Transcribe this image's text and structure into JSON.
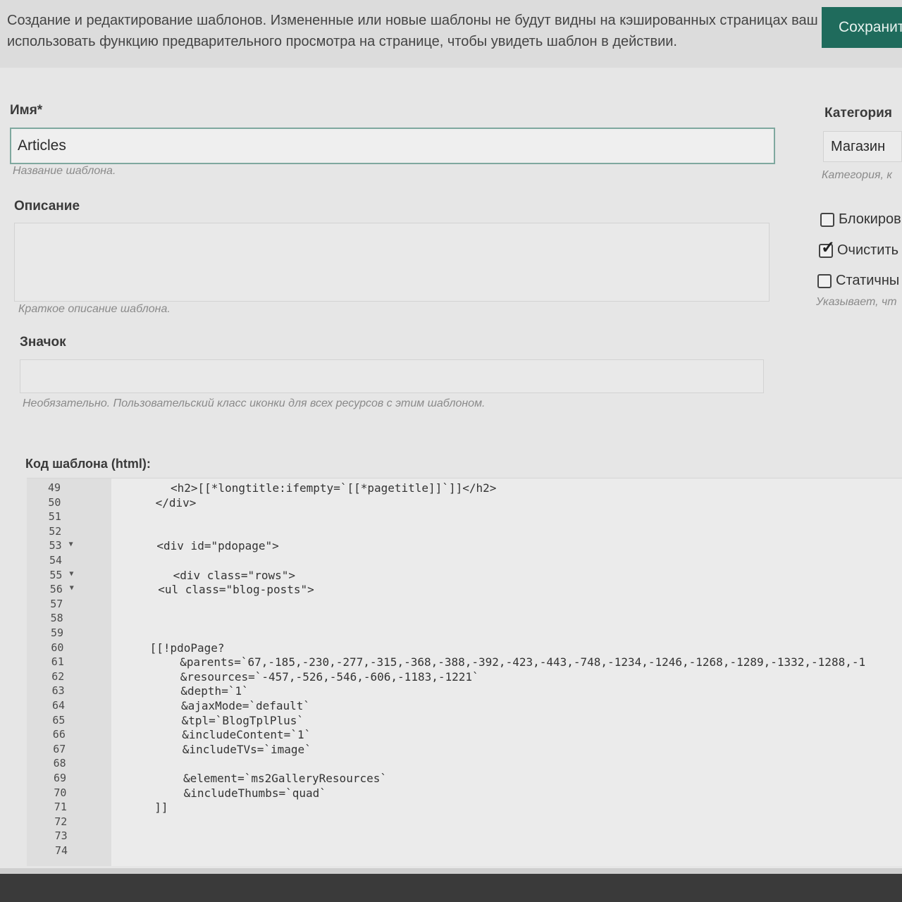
{
  "header": {
    "intro_line1": "Создание и редактирование шаблонов. Измененные или новые шаблоны не будут видны на кэшированных страницах ваш",
    "intro_line2": "использовать функцию предварительного просмотра на странице, чтобы увидеть шаблон в действии.",
    "save_label": "Сохранит"
  },
  "form": {
    "name_label": "Имя*",
    "name_value": "Articles",
    "name_help": "Название шаблона.",
    "description_label": "Описание",
    "description_value": "",
    "description_help": "Краткое описание шаблона.",
    "icon_label": "Значок",
    "icon_value": "",
    "icon_help": "Необязательно. Пользовательский класс иконки для всех ресурсов с этим шаблоном.",
    "category_label": "Категория",
    "category_value": "Магазин",
    "category_help": "Категория, к",
    "checkboxes": [
      {
        "label": "Блокиров",
        "checked": false
      },
      {
        "label": "Очистить",
        "checked": true
      },
      {
        "label": "Статичны",
        "checked": false
      }
    ],
    "static_help": "Указывает, чт"
  },
  "code_editor": {
    "label": "Код шаблона (html):",
    "lines": [
      {
        "n": "49",
        "fold": false,
        "indent": 3,
        "text": "<h2>[[*longtitle:ifempty=`[[*pagetitle]]`]]</h2>"
      },
      {
        "n": "50",
        "fold": false,
        "indent": 2,
        "text": "</div>"
      },
      {
        "n": "51",
        "fold": false,
        "indent": 0,
        "text": ""
      },
      {
        "n": "52",
        "fold": false,
        "indent": 0,
        "text": ""
      },
      {
        "n": "53",
        "fold": true,
        "indent": 2,
        "text": "<div id=\"pdopage\">"
      },
      {
        "n": "54",
        "fold": false,
        "indent": 0,
        "text": ""
      },
      {
        "n": "55",
        "fold": true,
        "indent": 3,
        "text": "<div class=\"rows\">"
      },
      {
        "n": "56",
        "fold": true,
        "indent": 2,
        "text": "<ul class=\"blog-posts\">"
      },
      {
        "n": "57",
        "fold": false,
        "indent": 0,
        "text": ""
      },
      {
        "n": "58",
        "fold": false,
        "indent": 0,
        "text": ""
      },
      {
        "n": "59",
        "fold": false,
        "indent": 0,
        "text": ""
      },
      {
        "n": "60",
        "fold": false,
        "indent": 1,
        "text": "[[!pdoPage?"
      },
      {
        "n": "61",
        "fold": false,
        "indent": 4,
        "text": "&parents=`67,-185,-230,-277,-315,-368,-388,-392,-423,-443,-748,-1234,-1246,-1268,-1289,-1332,-1288,-1"
      },
      {
        "n": "62",
        "fold": false,
        "indent": 4,
        "text": "&resources=`-457,-526,-546,-606,-1183,-1221`"
      },
      {
        "n": "63",
        "fold": false,
        "indent": 4,
        "text": "&depth=`1`"
      },
      {
        "n": "64",
        "fold": false,
        "indent": 4,
        "text": "&ajaxMode=`default`"
      },
      {
        "n": "65",
        "fold": false,
        "indent": 4,
        "text": "&tpl=`BlogTplPlus`"
      },
      {
        "n": "66",
        "fold": false,
        "indent": 4,
        "text": "&includeContent=`1`"
      },
      {
        "n": "67",
        "fold": false,
        "indent": 4,
        "text": "&includeTVs=`image`"
      },
      {
        "n": "68",
        "fold": false,
        "indent": 0,
        "text": ""
      },
      {
        "n": "69",
        "fold": false,
        "indent": 4,
        "text": "&element=`ms2GalleryResources`"
      },
      {
        "n": "70",
        "fold": false,
        "indent": 4,
        "text": "&includeThumbs=`quad`"
      },
      {
        "n": "71",
        "fold": false,
        "indent": 1,
        "text": "]]"
      },
      {
        "n": "72",
        "fold": false,
        "indent": 0,
        "text": ""
      },
      {
        "n": "73",
        "fold": false,
        "indent": 0,
        "text": ""
      },
      {
        "n": "74",
        "fold": false,
        "indent": 0,
        "text": ""
      }
    ]
  }
}
